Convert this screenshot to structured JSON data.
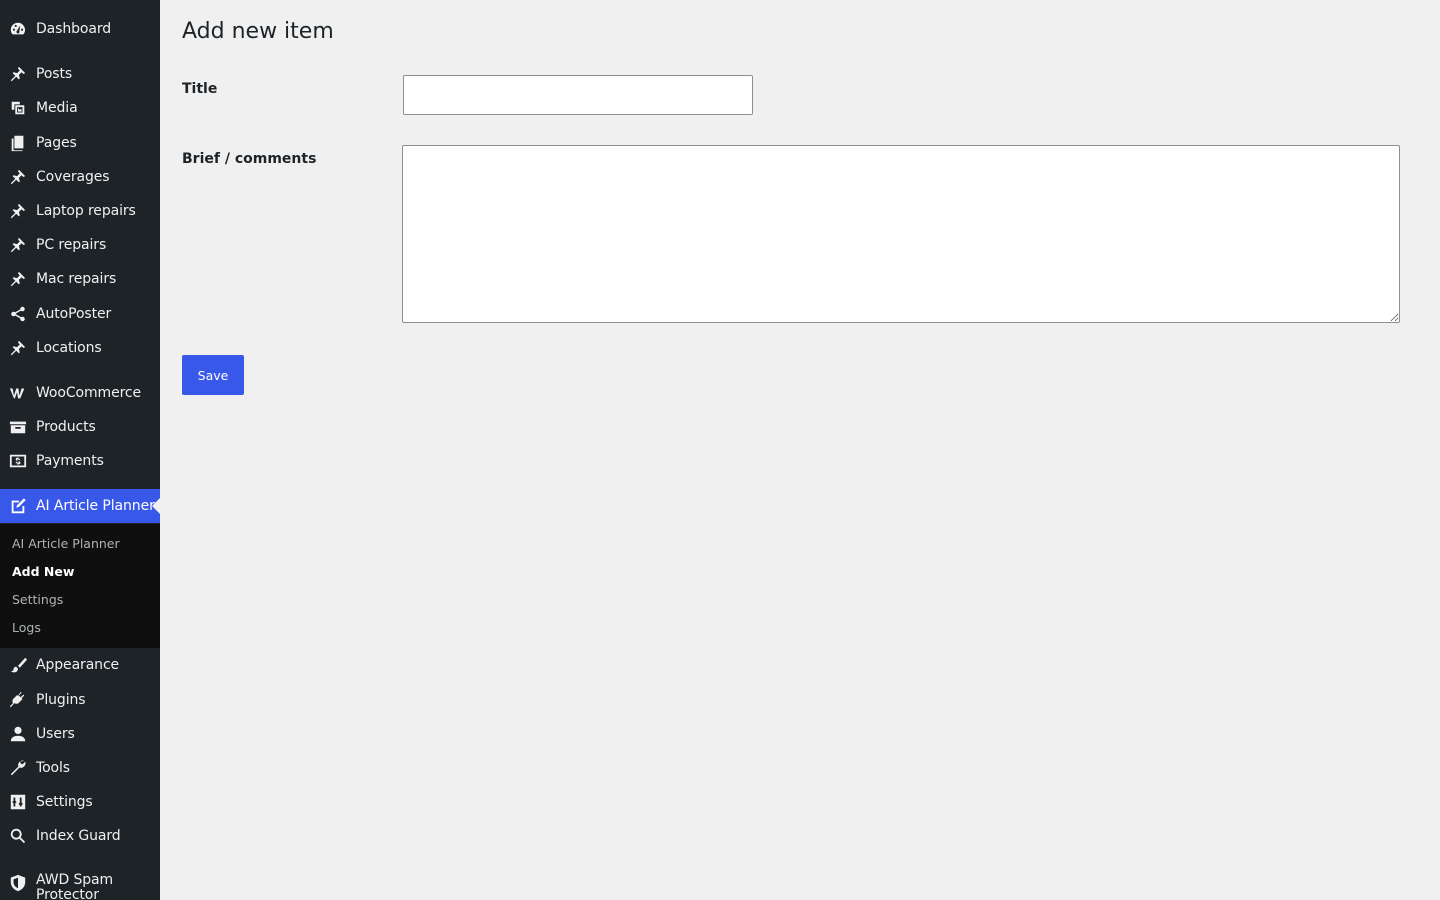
{
  "sidebar": {
    "items": [
      {
        "label": "Dashboard",
        "icon": "dashboard-icon"
      },
      {
        "label": "Posts",
        "icon": "pin-icon"
      },
      {
        "label": "Media",
        "icon": "media-icon"
      },
      {
        "label": "Pages",
        "icon": "pages-icon"
      },
      {
        "label": "Coverages",
        "icon": "pin-icon"
      },
      {
        "label": "Laptop repairs",
        "icon": "pin-icon"
      },
      {
        "label": "PC repairs",
        "icon": "pin-icon"
      },
      {
        "label": "Mac repairs",
        "icon": "pin-icon"
      },
      {
        "label": "AutoPoster",
        "icon": "share-icon"
      },
      {
        "label": "Locations",
        "icon": "pin-icon"
      },
      {
        "label": "WooCommerce",
        "icon": "woocommerce-icon"
      },
      {
        "label": "Products",
        "icon": "archive-icon"
      },
      {
        "label": "Payments",
        "icon": "dollar-icon"
      },
      {
        "label": "AI Article Planner",
        "icon": "edit-page-icon"
      },
      {
        "label": "Appearance",
        "icon": "paintbrush-icon"
      },
      {
        "label": "Plugins",
        "icon": "plug-icon"
      },
      {
        "label": "Users",
        "icon": "user-icon"
      },
      {
        "label": "Tools",
        "icon": "wrench-icon"
      },
      {
        "label": "Settings",
        "icon": "sliders-icon"
      },
      {
        "label": "Index Guard",
        "icon": "search-icon"
      },
      {
        "label": "AWD Spam Protector",
        "icon": "shield-icon"
      }
    ],
    "submenu": [
      {
        "label": "AI Article Planner"
      },
      {
        "label": "Add New"
      },
      {
        "label": "Settings"
      },
      {
        "label": "Logs"
      }
    ],
    "current": "AI Article Planner",
    "current_sub": "Add New"
  },
  "main": {
    "title": "Add new item",
    "title_label": "Title",
    "title_value": "",
    "brief_label": "Brief / comments",
    "brief_value": "",
    "save_label": "Save"
  },
  "colors": {
    "sidebar_bg": "#1d2327",
    "submenu_bg": "#0f0f0f",
    "accent": "#3858e9",
    "page_bg": "#f0f0f1"
  }
}
